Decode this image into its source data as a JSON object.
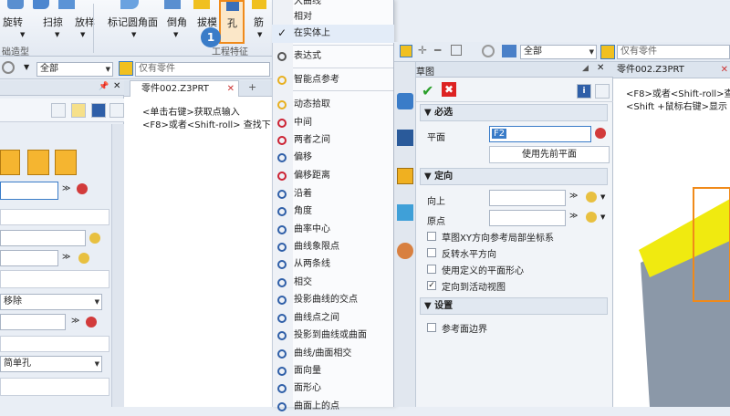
{
  "ribbon": {
    "buttons": [
      "旋转",
      "扫掠",
      "放样",
      "标记圆角面",
      "倒角",
      "拔模",
      "孔",
      "筋"
    ],
    "group_left": "础造型",
    "group_right": "工程特征",
    "step_badge": "1"
  },
  "filter_bar_left": {
    "combo": "全部",
    "filter": "仅有零件"
  },
  "filter_bar_right": {
    "combo": "全部",
    "filter": "仅有零件"
  },
  "left_panel": {
    "combo_remove": "移除",
    "combo_hole": "简单孔",
    "field_value": ""
  },
  "center_doc": {
    "tab": "零件002.Z3PRT",
    "hint1": "<单击右键>获取点输入",
    "hint2": "<F8>或者<Shift-roll> 查找下"
  },
  "context_menu": {
    "items": [
      {
        "label": "大曲线",
        "icon": "none",
        "checked": false
      },
      {
        "label": "相对",
        "icon": "none",
        "checked": false
      },
      {
        "label": "在实体上",
        "icon": "check",
        "checked": true
      },
      {
        "label": "表达式",
        "icon": "pi-icon",
        "checked": false
      },
      {
        "label": "智能点参考",
        "icon": "smart-point-icon",
        "checked": false
      },
      {
        "label": "动态拾取",
        "icon": "dynamic-pick-icon",
        "checked": false
      },
      {
        "label": "中间",
        "icon": "midpoint-icon",
        "checked": false
      },
      {
        "label": "两者之间",
        "icon": "between-icon",
        "checked": false
      },
      {
        "label": "偏移",
        "icon": "offset-icon",
        "checked": false
      },
      {
        "label": "偏移距离",
        "icon": "offset-distance-icon",
        "checked": false
      },
      {
        "label": "沿着",
        "icon": "along-icon",
        "checked": false
      },
      {
        "label": "角度",
        "icon": "angle-icon",
        "checked": false
      },
      {
        "label": "曲率中心",
        "icon": "curvature-center-icon",
        "checked": false
      },
      {
        "label": "曲线象限点",
        "icon": "quadrant-icon",
        "checked": false
      },
      {
        "label": "从两条线",
        "icon": "two-lines-icon",
        "checked": false
      },
      {
        "label": "相交",
        "icon": "intersect-icon",
        "checked": false
      },
      {
        "label": "投影曲线的交点",
        "icon": "project-intersect-icon",
        "checked": false
      },
      {
        "label": "曲线点之间",
        "icon": "curve-points-icon",
        "checked": false
      },
      {
        "label": "投影到曲线或曲面",
        "icon": "project-icon",
        "checked": false
      },
      {
        "label": "曲线/曲面相交",
        "icon": "curve-surface-icon",
        "checked": false
      },
      {
        "label": "面向量",
        "icon": "face-vector-icon",
        "checked": false
      },
      {
        "label": "面形心",
        "icon": "face-centroid-icon",
        "checked": false
      },
      {
        "label": "曲面上的点",
        "icon": "surface-point-icon",
        "checked": false
      }
    ]
  },
  "sketch_panel": {
    "title": "草图",
    "section_required": "必选",
    "label_plane": "平面",
    "plane_value": "F2",
    "btn_use_prev": "使用先前平面",
    "section_orient": "定向",
    "label_up": "向上",
    "label_origin": "原点",
    "chk_xy": "草图XY方向参考局部坐标系",
    "chk_flip": "反转水平方向",
    "chk_centroid": "使用定义的平面形心",
    "chk_active_view": "定向到活动视图",
    "section_settings": "设置",
    "chk_boundary": "参考面边界"
  },
  "right_doc": {
    "tab": "零件002.Z3PRT",
    "hint1": "<F8>或者<Shift-roll>查",
    "hint2": "<Shift +鼠标右键>显示"
  },
  "colors": {
    "accent": "#3a7cc8",
    "orange": "#f08a1a",
    "yellow": "#f0ea10",
    "body": "#8b98a8"
  }
}
